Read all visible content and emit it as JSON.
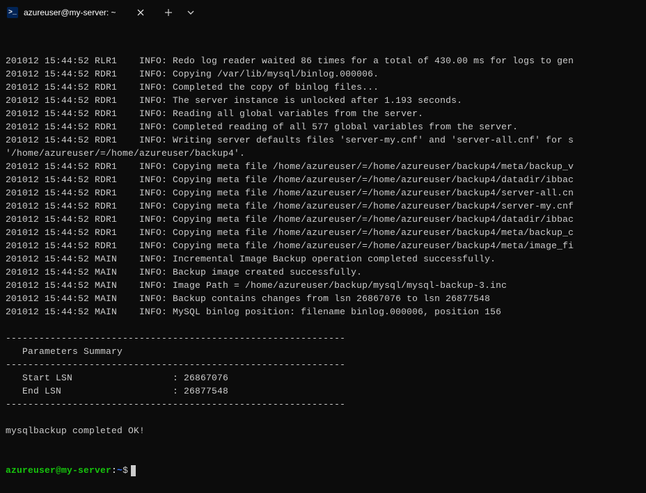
{
  "tab": {
    "title": "azureuser@my-server: ~",
    "icon_glyph": ">_"
  },
  "log_lines": [
    "201012 15:44:52 RLR1    INFO: Redo log reader waited 86 times for a total of 430.00 ms for logs to gen",
    "201012 15:44:52 RDR1    INFO: Copying /var/lib/mysql/binlog.000006.",
    "201012 15:44:52 RDR1    INFO: Completed the copy of binlog files...",
    "201012 15:44:52 RDR1    INFO: The server instance is unlocked after 1.193 seconds.",
    "201012 15:44:52 RDR1    INFO: Reading all global variables from the server.",
    "201012 15:44:52 RDR1    INFO: Completed reading of all 577 global variables from the server.",
    "201012 15:44:52 RDR1    INFO: Writing server defaults files 'server-my.cnf' and 'server-all.cnf' for s",
    "'/home/azureuser/=/home/azureuser/backup4'.",
    "201012 15:44:52 RDR1    INFO: Copying meta file /home/azureuser/=/home/azureuser/backup4/meta/backup_v",
    "201012 15:44:52 RDR1    INFO: Copying meta file /home/azureuser/=/home/azureuser/backup4/datadir/ibbac",
    "201012 15:44:52 RDR1    INFO: Copying meta file /home/azureuser/=/home/azureuser/backup4/server-all.cn",
    "201012 15:44:52 RDR1    INFO: Copying meta file /home/azureuser/=/home/azureuser/backup4/server-my.cnf",
    "201012 15:44:52 RDR1    INFO: Copying meta file /home/azureuser/=/home/azureuser/backup4/datadir/ibbac",
    "201012 15:44:52 RDR1    INFO: Copying meta file /home/azureuser/=/home/azureuser/backup4/meta/backup_c",
    "201012 15:44:52 RDR1    INFO: Copying meta file /home/azureuser/=/home/azureuser/backup4/meta/image_fi",
    "201012 15:44:52 MAIN    INFO: Incremental Image Backup operation completed successfully.",
    "201012 15:44:52 MAIN    INFO: Backup image created successfully.",
    "201012 15:44:52 MAIN    INFO: Image Path = /home/azureuser/backup/mysql/mysql-backup-3.inc",
    "201012 15:44:52 MAIN    INFO: Backup contains changes from lsn 26867076 to lsn 26877548",
    "201012 15:44:52 MAIN    INFO: MySQL binlog position: filename binlog.000006, position 156",
    "",
    "-------------------------------------------------------------",
    "   Parameters Summary         ",
    "-------------------------------------------------------------",
    "   Start LSN                  : 26867076",
    "   End LSN                    : 26877548",
    "-------------------------------------------------------------",
    "",
    "mysqlbackup completed OK!"
  ],
  "prompt": {
    "user_host": "azureuser@my-server",
    "colon": ":",
    "path": "~",
    "dollar": "$"
  }
}
